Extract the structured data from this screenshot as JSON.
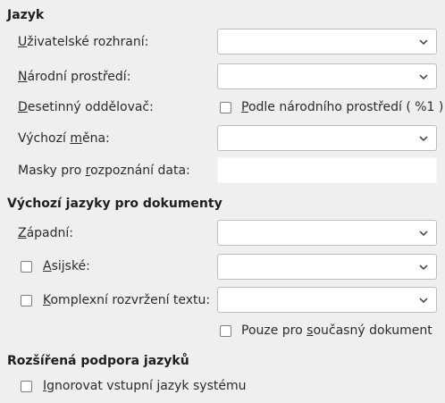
{
  "sections": {
    "language": {
      "heading": "Jazyk"
    },
    "default_languages": {
      "heading": "Výchozí jazyky pro dokumenty"
    },
    "enhanced": {
      "heading": "Rozšířená podpora jazyků"
    }
  },
  "fields": {
    "user_interface": {
      "mn": "U",
      "rest": "živatelské rozhraní:",
      "value": ""
    },
    "locale": {
      "mn": "N",
      "rest": "árodní prostředí:",
      "value": ""
    },
    "decimal_separator": {
      "mn": "D",
      "rest": "esetinný oddělovač:"
    },
    "decimal_checkbox": {
      "mn": "P",
      "rest": "odle národního prostředí ( %1 )",
      "checked": false
    },
    "default_currency": {
      "pre": "Výchozí ",
      "mn": "m",
      "rest": "ěna:",
      "value": ""
    },
    "date_patterns": {
      "pre": "Masky pro ",
      "mn": "r",
      "rest": "ozpoznání data:",
      "value": ""
    },
    "western": {
      "mn": "Z",
      "rest": "ápadní:",
      "value": ""
    },
    "asian": {
      "mn": "A",
      "rest": "sijské:",
      "checked": false,
      "value": ""
    },
    "ctl": {
      "mn": "K",
      "rest": "omplexní rozvržení textu:",
      "checked": false,
      "value": ""
    },
    "current_doc": {
      "pre": "Pouze pro ",
      "mn": "s",
      "rest": "oučasný dokument",
      "checked": false
    },
    "ignore_input": {
      "mn": "I",
      "rest": "gnorovat vstupní jazyk systému",
      "checked": false
    }
  },
  "icons": {
    "dropdown": "chevron-down-icon"
  }
}
